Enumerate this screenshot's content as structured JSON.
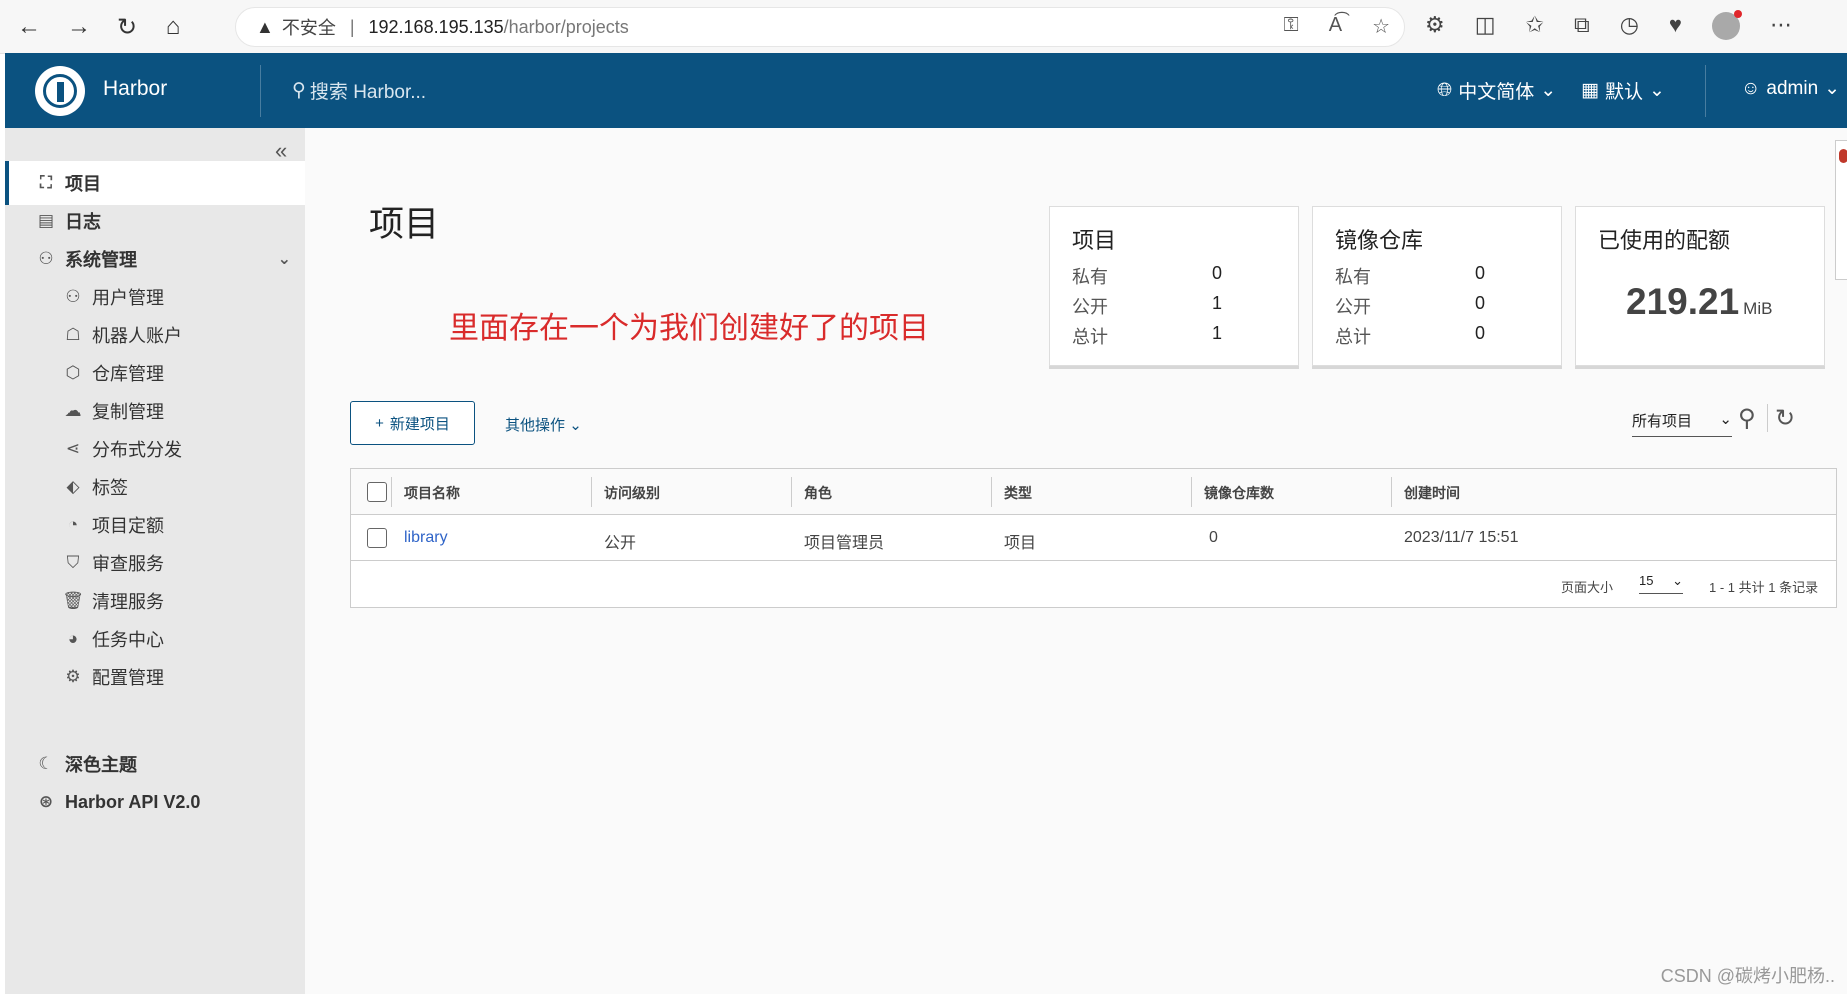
{
  "browser": {
    "warning": "不安全",
    "url_host": "192.168.195.135",
    "url_path": "/harbor/projects",
    "icons": [
      "back-icon",
      "forward-icon",
      "refresh-icon",
      "home-icon"
    ]
  },
  "header": {
    "brand": "Harbor",
    "search_placeholder": "搜索 Harbor...",
    "language": "中文简体",
    "scope": "默认",
    "user": "admin"
  },
  "sidebar": {
    "items": [
      {
        "label": "项目",
        "icon": "projects-icon"
      },
      {
        "label": "日志",
        "icon": "logs-icon"
      },
      {
        "label": "系统管理",
        "icon": "admin-icon"
      }
    ],
    "sub_items": [
      {
        "label": "用户管理"
      },
      {
        "label": "机器人账户"
      },
      {
        "label": "仓库管理"
      },
      {
        "label": "复制管理"
      },
      {
        "label": "分布式分发"
      },
      {
        "label": "标签"
      },
      {
        "label": "项目定额"
      },
      {
        "label": "审查服务"
      },
      {
        "label": "清理服务"
      },
      {
        "label": "任务中心"
      },
      {
        "label": "配置管理"
      }
    ],
    "dark_theme": "深色主题",
    "api": "Harbor API V2.0"
  },
  "main": {
    "title": "项目",
    "annotation": "里面存在一个为我们创建好了的项目",
    "cards": {
      "projects": {
        "title": "项目",
        "rows": [
          {
            "label": "私有",
            "value": "0"
          },
          {
            "label": "公开",
            "value": "1"
          },
          {
            "label": "总计",
            "value": "1"
          }
        ]
      },
      "repos": {
        "title": "镜像仓库",
        "rows": [
          {
            "label": "私有",
            "value": "0"
          },
          {
            "label": "公开",
            "value": "0"
          },
          {
            "label": "总计",
            "value": "0"
          }
        ]
      },
      "quota": {
        "title": "已使用的配额",
        "value": "219.21",
        "unit": "MiB"
      }
    },
    "new_project": "新建项目",
    "other_actions": "其他操作",
    "filter": "所有项目",
    "table": {
      "headers": [
        "项目名称",
        "访问级别",
        "角色",
        "类型",
        "镜像仓库数",
        "创建时间"
      ],
      "rows": [
        {
          "name": "library",
          "access": "公开",
          "role": "项目管理员",
          "type": "项目",
          "repos": "0",
          "created": "2023/11/7 15:51"
        }
      ],
      "page_size_label": "页面大小",
      "page_size": "15",
      "page_info": "1 - 1 共计 1 条记录"
    }
  },
  "watermark": "CSDN @碳烤小肥杨.."
}
